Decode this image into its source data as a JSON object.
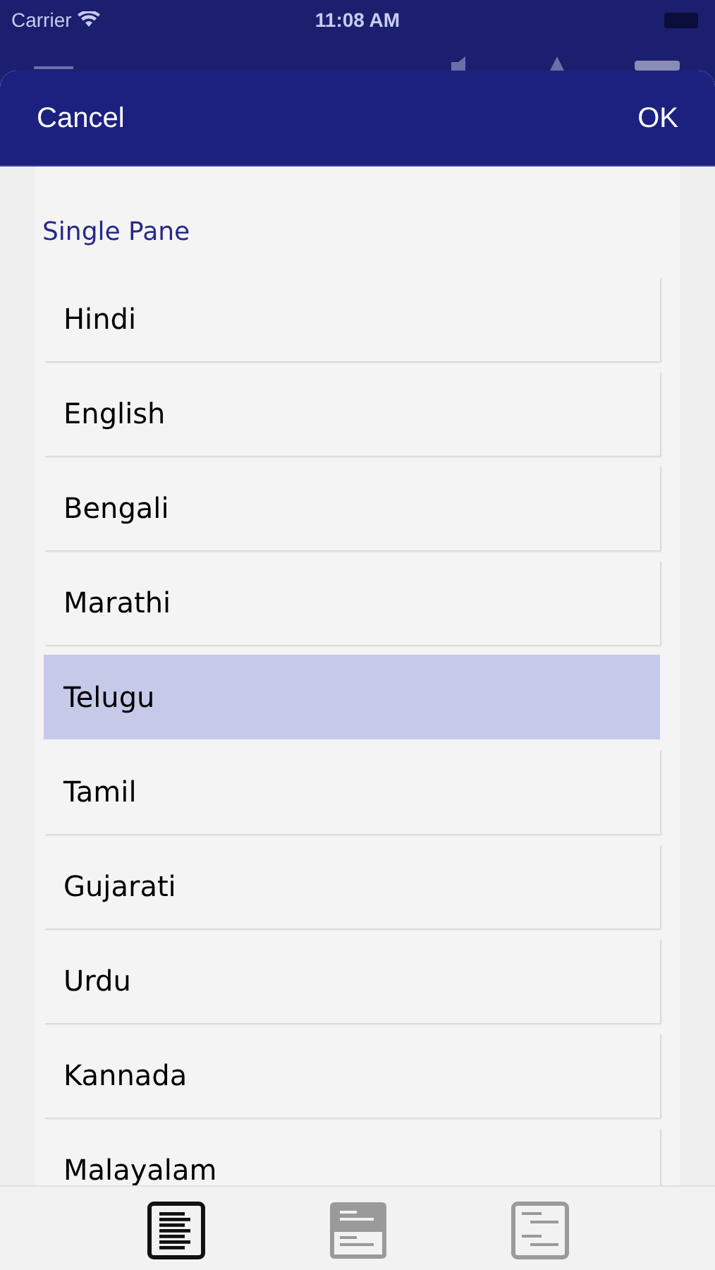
{
  "status_bar": {
    "carrier": "Carrier",
    "time": "11:08 AM"
  },
  "dialog": {
    "cancel": "Cancel",
    "ok": "OK",
    "section_title": "Single Pane",
    "languages": [
      {
        "label": "Hindi",
        "selected": false
      },
      {
        "label": "English",
        "selected": false
      },
      {
        "label": "Bengali",
        "selected": false
      },
      {
        "label": "Marathi",
        "selected": false
      },
      {
        "label": "Telugu",
        "selected": true
      },
      {
        "label": "Tamil",
        "selected": false
      },
      {
        "label": "Gujarati",
        "selected": false
      },
      {
        "label": "Urdu",
        "selected": false
      },
      {
        "label": "Kannada",
        "selected": false
      },
      {
        "label": "Malayalam",
        "selected": false
      }
    ]
  },
  "bottom_tabs": [
    {
      "kind": "single",
      "selected": true
    },
    {
      "kind": "split",
      "selected": false
    },
    {
      "kind": "parallel",
      "selected": false
    }
  ]
}
